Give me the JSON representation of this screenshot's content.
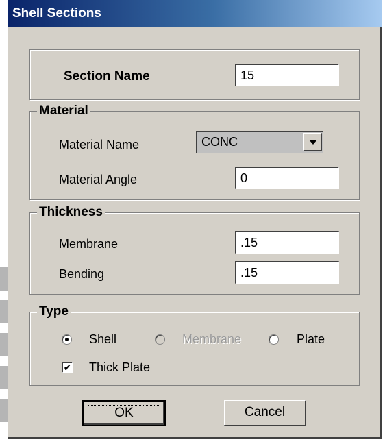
{
  "window": {
    "title": "Shell Sections"
  },
  "section_name": {
    "label": "Section Name",
    "value": "15"
  },
  "material": {
    "group_title": "Material",
    "name_label": "Material Name",
    "name_value": "CONC",
    "angle_label": "Material Angle",
    "angle_value": "0"
  },
  "thickness": {
    "group_title": "Thickness",
    "membrane_label": "Membrane",
    "membrane_value": ".15",
    "bending_label": "Bending",
    "bending_value": ".15"
  },
  "type": {
    "group_title": "Type",
    "options": [
      {
        "label": "Shell",
        "selected": true,
        "enabled": true
      },
      {
        "label": "Membrane",
        "selected": false,
        "enabled": false
      },
      {
        "label": "Plate",
        "selected": false,
        "enabled": true
      }
    ],
    "thick_plate_label": "Thick Plate",
    "thick_plate_checked": true,
    "check_glyph": "✔"
  },
  "buttons": {
    "ok_label": "OK",
    "cancel_label": "Cancel"
  },
  "colors": {
    "dialog_bg": "#d4d0c8",
    "title_start": "#0a246a",
    "title_end": "#a6caf0"
  }
}
